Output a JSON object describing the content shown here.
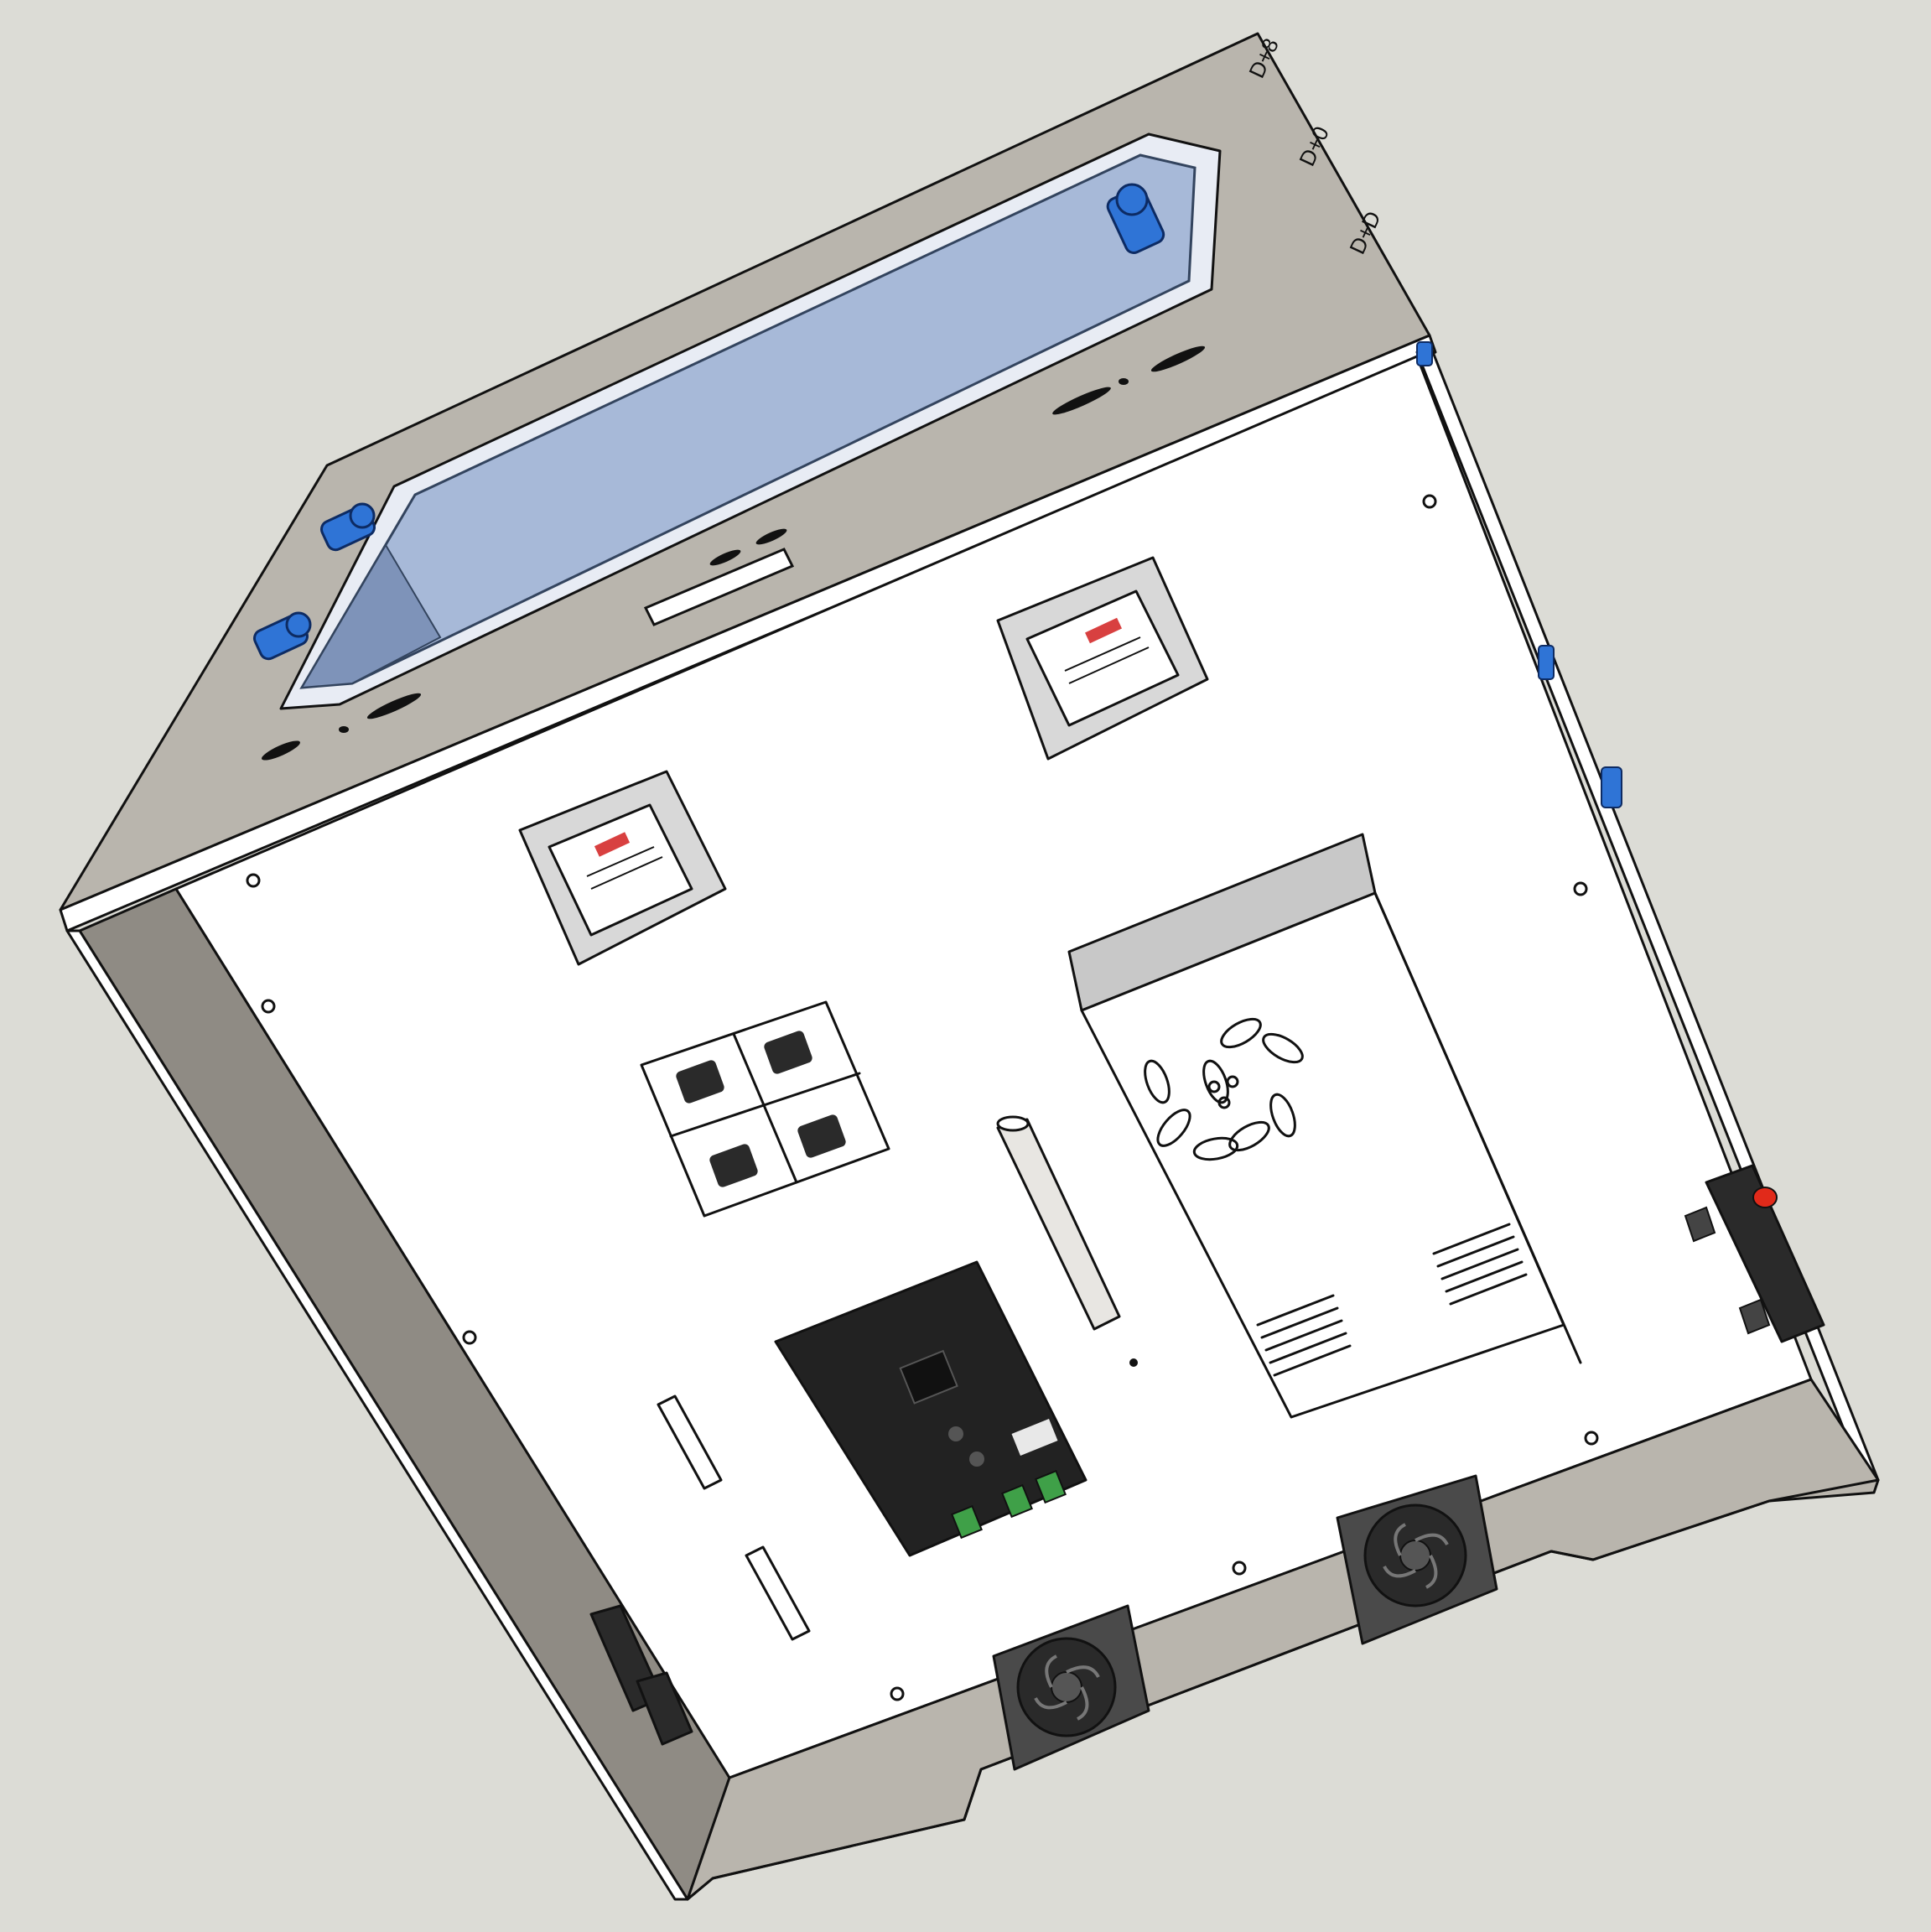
{
  "scene": {
    "background": "#dcdcd6",
    "panel_color": "#b9b5ad",
    "panel_shadow": "#8f8b84",
    "base_plate_color": "#ffffff",
    "window_color": "#a7b9d8",
    "clip_color": "#2f74d6",
    "component_dark": "#2a2a2a",
    "relay_label_color": "#d84040",
    "connector_green": "#3fa048",
    "switch_red": "#e12a1a"
  },
  "top_panel_marks": [
    "D+8",
    "D+0",
    "D+D"
  ]
}
